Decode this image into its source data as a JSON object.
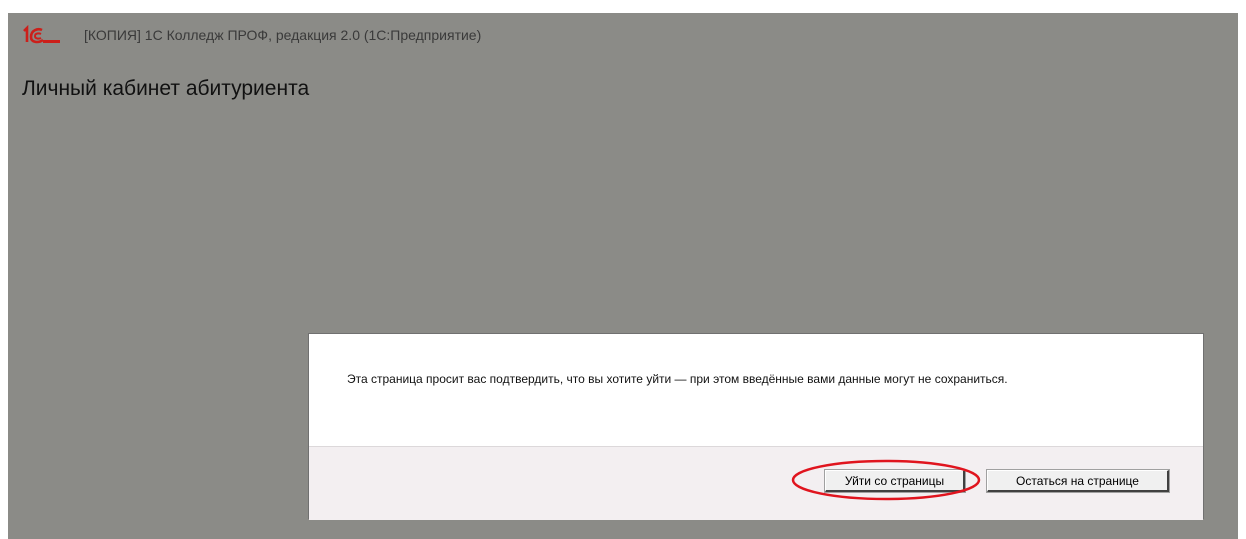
{
  "window": {
    "app_title": "[КОПИЯ] 1С Колледж ПРОФ, редакция 2.0  (1С:Предприятие)",
    "logo_icon": "1c-logo-icon"
  },
  "page": {
    "title": "Личный кабинет абитуриента"
  },
  "dialog": {
    "message": "Эта страница просит вас подтвердить, что вы хотите уйти — при этом введённые вами данные могут не сохраниться.",
    "leave_button": "Уйти со страницы",
    "stay_button": "Остаться на странице"
  },
  "colors": {
    "overlay": "#8b8b87",
    "logo": "#cc1f1a",
    "highlight": "#e0141e"
  }
}
